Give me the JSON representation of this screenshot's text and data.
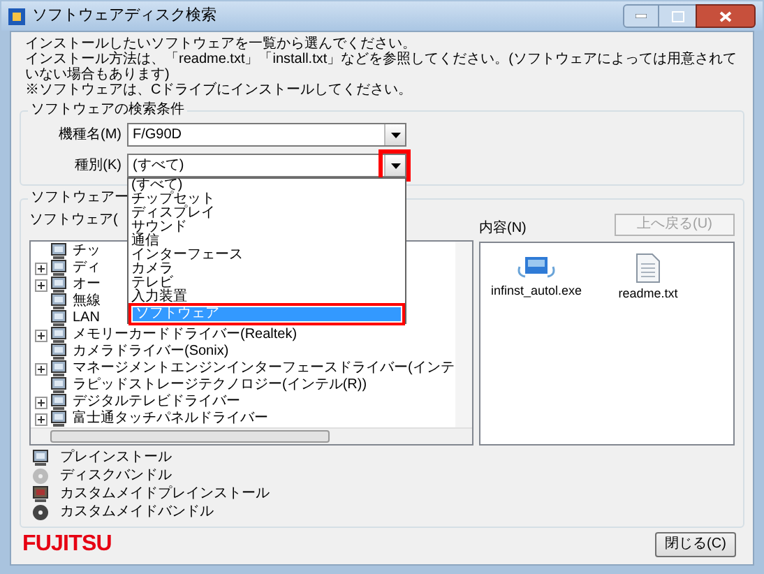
{
  "window": {
    "title": "ソフトウェアディスク検索"
  },
  "instructions": [
    "インストールしたいソフトウェアを一覧から選んでください。",
    "インストール方法は、「readme.txt」「install.txt」などを参照してください。(ソフトウェアによっては用意されていない場合もあります)",
    "※ソフトウェアは、Cドライブにインストールしてください。"
  ],
  "search_group": {
    "title": "ソフトウェアの検索条件",
    "fields": [
      {
        "label": "機種名(M)",
        "value": "F/G90D",
        "highlighted": false
      },
      {
        "label": "種別(K)",
        "value": "(すべて)",
        "highlighted": true
      }
    ],
    "dropdown": [
      {
        "label": "(すべて)",
        "selected": false
      },
      {
        "label": "チップセット",
        "selected": false
      },
      {
        "label": "ディスプレイ",
        "selected": false
      },
      {
        "label": "サウンド",
        "selected": false
      },
      {
        "label": "通信",
        "selected": false
      },
      {
        "label": "インターフェース",
        "selected": false
      },
      {
        "label": "カメラ",
        "selected": false
      },
      {
        "label": "テレビ",
        "selected": false
      },
      {
        "label": "入力装置",
        "selected": false
      },
      {
        "label": "ソフトウェア",
        "selected": true
      }
    ]
  },
  "software_group": {
    "title": "ソフトウェアー",
    "tree_label": "ソフトウェア(",
    "tree": [
      {
        "label": "チッ",
        "expandable": false
      },
      {
        "label": "ディ",
        "expandable": true
      },
      {
        "label": "オー",
        "expandable": true
      },
      {
        "label": "無線",
        "expandable": false
      },
      {
        "label": "LAN",
        "expandable": false
      },
      {
        "label": "メモリーカードドライバー(Realtek)",
        "expandable": true
      },
      {
        "label": "カメラドライバー(Sonix)",
        "expandable": false
      },
      {
        "label": "マネージメントエンジンインターフェースドライバー(インテ",
        "expandable": true
      },
      {
        "label": "ラピッドストレージテクノロジー(インテル(R))",
        "expandable": false
      },
      {
        "label": "デジタルテレビドライバー",
        "expandable": true
      },
      {
        "label": "富士通タッチパネルドライバー",
        "expandable": true
      }
    ],
    "contents_label": "内容(N)",
    "up_button": {
      "label": "上へ戻る(U)",
      "disabled": true
    },
    "files": [
      {
        "name": "infinst_autol.exe",
        "kind": "exe"
      },
      {
        "name": "readme.txt",
        "kind": "text"
      }
    ]
  },
  "legend": [
    {
      "label": "プレインストール",
      "kind": "preinstall"
    },
    {
      "label": "ディスクバンドル",
      "kind": "bundle"
    },
    {
      "label": "カスタムメイドプレインストール",
      "kind": "custom-preinstall"
    },
    {
      "label": "カスタムメイドバンドル",
      "kind": "custom-bundle"
    }
  ],
  "logo": "FUJITSU",
  "close_button": "閉じる(C)"
}
